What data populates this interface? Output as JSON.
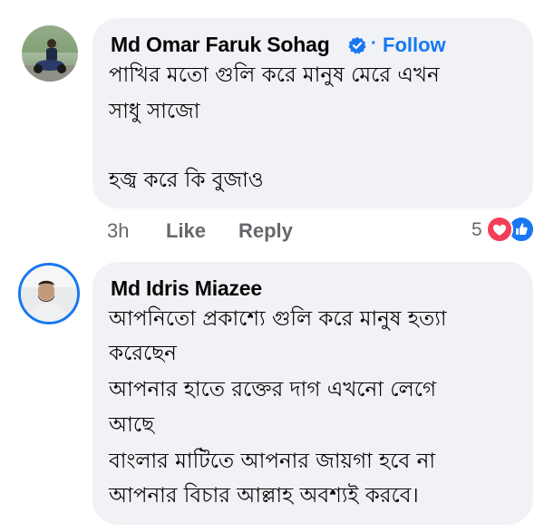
{
  "comments": [
    {
      "author": "Md Omar Faruk Sohag",
      "follow_label": "Follow",
      "separator": "·",
      "lines": [
        "পাখির মতো  গুলি করে মানুষ মেরে এখন",
        "সাধু সাজো",
        "",
        "হজ্ব করে কি বুজাও"
      ],
      "time": "3h",
      "like_label": "Like",
      "reply_label": "Reply",
      "reaction_count": "5",
      "reaction_colors": {
        "love": "#f33e58",
        "like": "#1877f2"
      }
    },
    {
      "author": "Md Idris Miazee",
      "lines": [
        "আপনিতো প্রকাশ্যে গুলি করে মানুষ হত্যা",
        "করেছেন",
        "আপনার হাতে রক্তের দাগ এখনো লেগে",
        "আছে",
        "বাংলার মাটিতে আপনার জায়গা হবে না",
        "আপনার বিচার আল্লাহ অবশ্যই করবে।"
      ]
    }
  ],
  "icons": {
    "verified": "verified-badge-icon",
    "love": "heart-icon",
    "like": "thumbs-up-icon"
  },
  "colors": {
    "bubble_bg": "#f0f2f5",
    "link_blue": "#1877f2",
    "meta_gray": "#65676b"
  }
}
